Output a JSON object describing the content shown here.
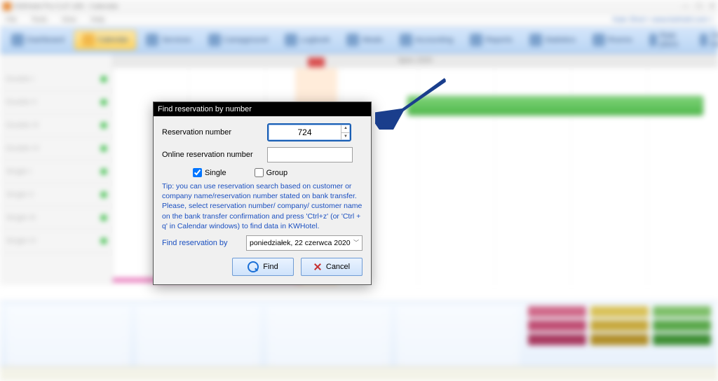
{
  "window": {
    "title": "KWHotel Pro 0.47.165 - Calendar"
  },
  "menubar": {
    "items": [
      "File",
      "Tools",
      "View",
      "Help"
    ],
    "right": "Kate  Short  •  www.kwhotel.com  •"
  },
  "toolbar": {
    "dashboard": "Dashboard",
    "calendar": "Calendar",
    "services": "Services",
    "campground": "Campground",
    "logbook": "Logbook",
    "meals": "Meals",
    "accounting": "Accounting",
    "reports": "Reports",
    "statistics": "Statistics",
    "rooms": "Rooms",
    "rateplans": "Rate plans",
    "online": "Online bookings"
  },
  "calendar_header": "lipiec  2020",
  "dialog": {
    "title": "Find reservation by number",
    "res_label": "Reservation number",
    "res_value": "724",
    "online_label": "Online reservation number",
    "single_label": "Single",
    "group_label": "Group",
    "tip": "Tip: you can use reservation search based on customer or company name/reservation number stated on bank transfer.\nPlease, select reservation number/ company/ customer name on the bank transfer confirmation and press 'Ctrl+z' (or 'Ctrl + q' in Calendar windows) to find data in KWHotel.",
    "findby_label": "Find reservation by",
    "date_value": "poniedziałek, 22   czerwca    2020",
    "find_btn": "Find",
    "cancel_btn": "Cancel"
  },
  "status_colors": {
    "row1": [
      "#d06a8a",
      "#d9c25a",
      "#7fbf6a"
    ],
    "row2": [
      "#c04f74",
      "#c7a93e",
      "#5aa84a"
    ],
    "row3": [
      "#a93a60",
      "#b28f2a",
      "#3f8f35"
    ]
  }
}
